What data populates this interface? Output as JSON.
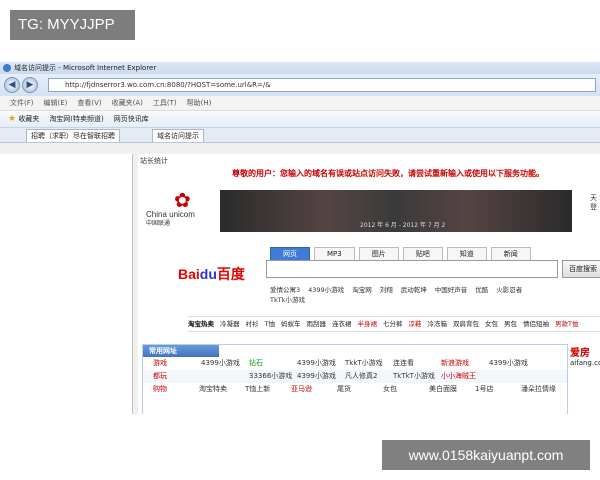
{
  "watermark_top": "TG: MYYJJPP",
  "watermark_bottom": "www.0158kaiyuanpt.com",
  "browser": {
    "title": "域名访问提示 - Microsoft Internet Explorer",
    "address": "http://fjdnserror3.wo.com.cn:8080/?HOST=some.url&R=/&",
    "menus": [
      "文件(F)",
      "编辑(E)",
      "查看(V)",
      "收藏夹(A)",
      "工具(T)",
      "帮助(H)"
    ],
    "favorites_label": "收藏夹",
    "fav_items": [
      "淘宝网(特卖频道)",
      "网页快讯库"
    ],
    "tabs": [
      "招聘（求职）尽在智联招聘",
      "域名访问提示"
    ]
  },
  "page": {
    "top_link": "站长统计",
    "notice": "尊敬的用户：您输入的域名有误或站点访问失败，请尝试重新输入或使用以下服务功能。",
    "logo_en": "China unicom",
    "logo_cn": "中国联通",
    "banner_date": "2012 年 6 月 - 2012 年 7 月 2",
    "side_text": "天 2 登",
    "search_tabs": [
      "网页",
      "MP3",
      "图片",
      "贴吧",
      "知道",
      "新闻"
    ],
    "baidu_left": "Bai",
    "baidu_mid": "du",
    "baidu_right": "百度",
    "search_button": "百度搜索",
    "suggestions": [
      "爱情公寓3",
      "4399小游戏",
      "淘宝网",
      "刘翔",
      "武动乾坤",
      "中国好声音",
      "优酷",
      "火影忍者"
    ],
    "suggestion2": "TkTk小游戏",
    "hot_label": "淘宝热卖",
    "hot_items": [
      "冷凝器",
      "衬衫",
      "T恤",
      "蚂蚁车",
      "雨刮器",
      "连衣裙",
      "半身裙",
      "七分裤",
      "凉鞋",
      "冷冻箱",
      "双肩背包",
      "女包",
      "男包",
      "情侣短袖",
      "男款T恤"
    ],
    "common_title": "常用网址",
    "rows": [
      {
        "cat": "游戏",
        "items": [
          "4399小游戏",
          "钻石",
          "4399小游戏",
          "TkkT小游戏",
          "连连看",
          "新浪游戏",
          "4399小游戏"
        ]
      },
      {
        "cat": "都玩",
        "items": [
          "",
          "33366小游戏",
          "4399小游戏",
          "凡人修真2",
          "TkTkT小游戏",
          "小小海贼王"
        ]
      },
      {
        "cat": "购物",
        "items": [
          "淘宝特卖",
          "T恤上新",
          "亚马逊",
          "尾货",
          "女包",
          "美白面膜",
          "1号店",
          "潘朵拉情缘"
        ]
      }
    ],
    "right_box": "爱房",
    "right_box_sub": "aifang.com"
  }
}
